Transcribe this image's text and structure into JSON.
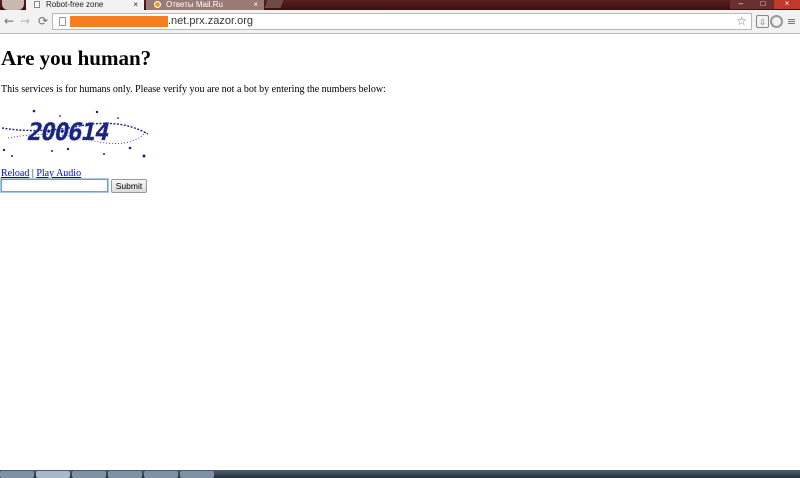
{
  "browser": {
    "tabs": [
      {
        "title": "Robot-free zone",
        "active": true,
        "close": "×"
      },
      {
        "title": "Ответы Mail.Ru",
        "active": false,
        "close": "×"
      }
    ],
    "window_controls": {
      "minimize": "–",
      "maximize": "□",
      "close": "×"
    },
    "nav": {
      "back": "←",
      "forward": "→",
      "reload": "⟳"
    },
    "address_bar": {
      "url_visible": ".net.prx.zazor.org",
      "redacted_color": "#f57e20",
      "star": "☆"
    },
    "toolbar_icons": {
      "extension_1": "⇩",
      "extension_2": "◎",
      "menu": "≡"
    }
  },
  "page": {
    "heading": "Are you human?",
    "intro": "This services is for humans only. Please verify you are not a bot by entering the numbers below:",
    "captcha": {
      "text": "200614",
      "color": "#1a237e"
    },
    "links": {
      "reload": "Reload",
      "separator": "|",
      "play_audio": "Play Audio"
    },
    "form": {
      "input_value": "",
      "submit_label": "Submit"
    }
  },
  "colors": {
    "link": "#0000ee",
    "titlebar": "#4a1616",
    "status_shield": "#4a9a38"
  }
}
